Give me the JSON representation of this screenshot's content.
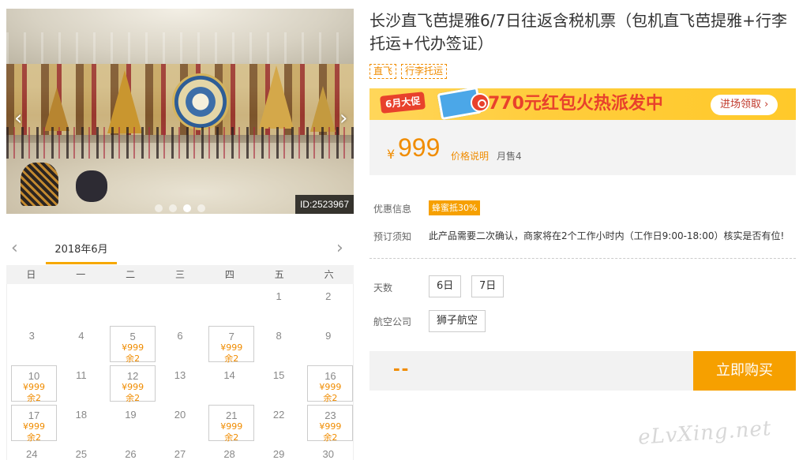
{
  "photo": {
    "id_label": "ID:2523967",
    "dots": [
      {
        "active": false
      },
      {
        "active": false
      },
      {
        "active": true
      },
      {
        "active": false
      }
    ],
    "prev_icon": "‹",
    "next_icon": "›"
  },
  "calendar": {
    "prev_icon": "‹",
    "next_icon": "›",
    "month": "2018年6月",
    "weekdays": [
      "日",
      "一",
      "二",
      "三",
      "四",
      "五",
      "六"
    ],
    "cells": [
      {
        "day": ""
      },
      {
        "day": ""
      },
      {
        "day": ""
      },
      {
        "day": ""
      },
      {
        "day": ""
      },
      {
        "day": "1"
      },
      {
        "day": "2"
      },
      {
        "day": "3"
      },
      {
        "day": "4"
      },
      {
        "day": "5",
        "price": "¥999",
        "left": "余2"
      },
      {
        "day": "6"
      },
      {
        "day": "7",
        "price": "¥999",
        "left": "余2"
      },
      {
        "day": "8"
      },
      {
        "day": "9"
      },
      {
        "day": "10",
        "price": "¥999",
        "left": "余2"
      },
      {
        "day": "11"
      },
      {
        "day": "12",
        "price": "¥999",
        "left": "余2"
      },
      {
        "day": "13"
      },
      {
        "day": "14"
      },
      {
        "day": "15"
      },
      {
        "day": "16",
        "price": "¥999",
        "left": "余2"
      },
      {
        "day": "17",
        "price": "¥999",
        "left": "余2"
      },
      {
        "day": "18"
      },
      {
        "day": "19"
      },
      {
        "day": "20"
      },
      {
        "day": "21",
        "price": "¥999",
        "left": "余2"
      },
      {
        "day": "22"
      },
      {
        "day": "23",
        "price": "¥999",
        "left": "余2"
      },
      {
        "day": "24"
      },
      {
        "day": "25"
      },
      {
        "day": "26"
      },
      {
        "day": "27"
      },
      {
        "day": "28"
      },
      {
        "day": "29"
      },
      {
        "day": "30"
      }
    ]
  },
  "product": {
    "title": "长沙直飞芭提雅6/7日往返含税机票（包机直飞芭提雅+行李托运+代办签证）",
    "tags": [
      "直飞",
      "行李托运"
    ]
  },
  "promo": {
    "june_badge": "6月大促",
    "headline": "770元红包火热派发中",
    "redeem_button": "进场领取 ›"
  },
  "price": {
    "currency": "¥",
    "amount": "999",
    "explain_link": "价格说明",
    "sold": "月售4"
  },
  "discount": {
    "label": "优惠信息",
    "badge": "蜂蜜抵30%"
  },
  "booking_notice": {
    "label": "预订须知",
    "text": "此产品需要二次确认，商家将在2个工作小时内（工作日9:00-18:00）核实是否有位!"
  },
  "days": {
    "label": "天数",
    "options": [
      "6日",
      "7日"
    ]
  },
  "airline": {
    "label": "航空公司",
    "options": [
      "狮子航空"
    ]
  },
  "buy": {
    "total": "--",
    "button": "立即购买"
  },
  "watermark": "eLvXing.net",
  "colors": {
    "accent": "#f6a000",
    "price": "#f08c00",
    "promo_red": "#e8412c"
  }
}
